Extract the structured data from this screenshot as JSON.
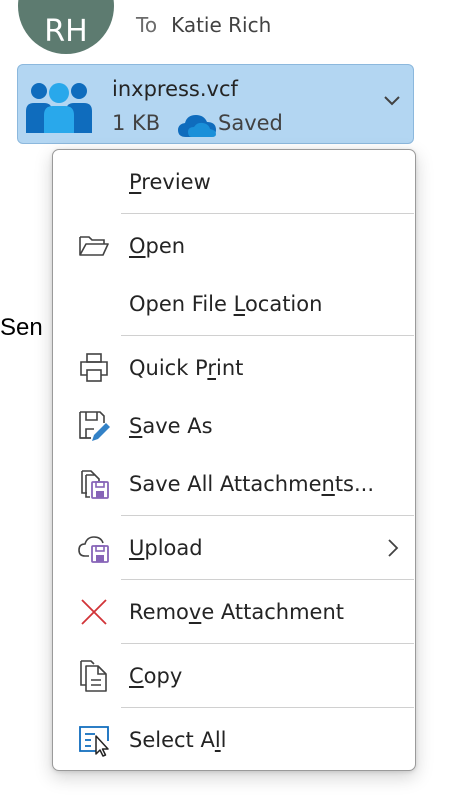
{
  "header": {
    "avatar_initials": "RH",
    "subject_partial": "",
    "to_label": "To",
    "recipient": "Katie Rich"
  },
  "attachment": {
    "icon": "contact-card-people-icon",
    "filename": "inxpress.vcf",
    "size": "1 KB",
    "cloud_icon": "onedrive-cloud-icon",
    "status": "Saved",
    "menu_icon": "chevron-down-icon"
  },
  "background": {
    "partial_text": "Sen"
  },
  "context_menu": {
    "items": [
      {
        "id": "preview",
        "pre": "",
        "accel": "P",
        "post": "review",
        "icon": ""
      },
      {
        "id": "open",
        "pre": "",
        "accel": "O",
        "post": "pen",
        "icon": "folder-open-icon"
      },
      {
        "id": "open-file-location",
        "pre": "Open File ",
        "accel": "L",
        "post": "ocation",
        "icon": ""
      },
      {
        "id": "quick-print",
        "pre": "Quick P",
        "accel": "r",
        "post": "int",
        "icon": "printer-icon"
      },
      {
        "id": "save-as",
        "pre": "",
        "accel": "S",
        "post": "ave As",
        "icon": "save-as-icon"
      },
      {
        "id": "save-all-attachments",
        "pre": "Save All Attachme",
        "accel": "n",
        "post": "ts...",
        "icon": "save-all-icon"
      },
      {
        "id": "upload",
        "pre": "",
        "accel": "U",
        "post": "pload",
        "icon": "cloud-upload-icon",
        "submenu": true
      },
      {
        "id": "remove-attachment",
        "pre": "Remo",
        "accel": "v",
        "post": "e Attachment",
        "icon": "close-x-icon"
      },
      {
        "id": "copy",
        "pre": "",
        "accel": "C",
        "post": "opy",
        "icon": "copy-icon"
      },
      {
        "id": "select-all",
        "pre": "Select A",
        "accel": "l",
        "post": "l",
        "icon": "select-all-icon"
      }
    ]
  },
  "colors": {
    "attachment_bg": "#b3d6f2",
    "avatar_bg": "#5d7b70",
    "accent_blue": "#0f6cbd",
    "remove_red": "#d13438",
    "save_purple": "#8764b8"
  }
}
